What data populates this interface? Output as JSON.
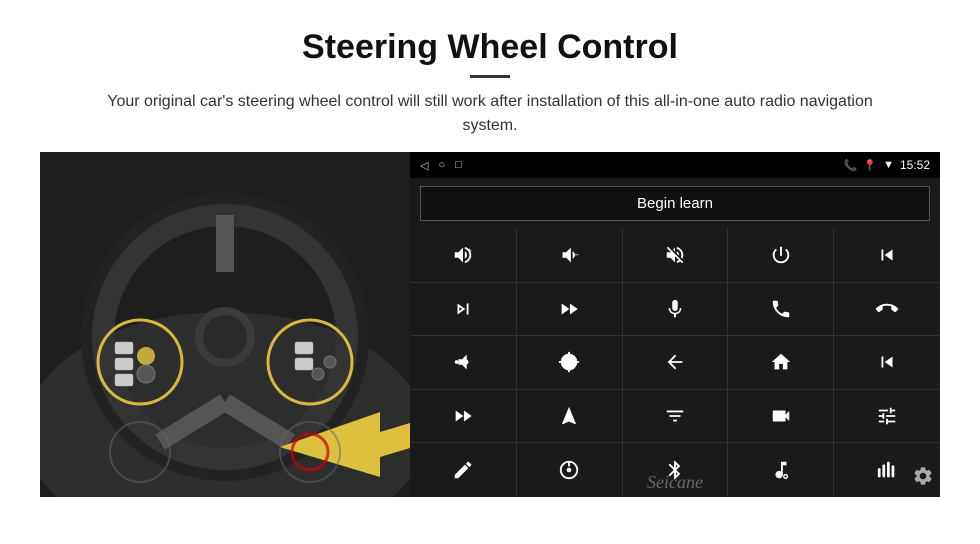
{
  "header": {
    "title": "Steering Wheel Control",
    "divider": true,
    "subtitle": "Your original car's steering wheel control will still work after installation of this all-in-one auto radio navigation system."
  },
  "statusBar": {
    "time": "15:52",
    "navIcons": [
      "◁",
      "○",
      "□"
    ]
  },
  "beginLearn": {
    "label": "Begin learn"
  },
  "watermark": "Seicane",
  "controlButtons": [
    {
      "id": "vol-up",
      "icon": "vol-up"
    },
    {
      "id": "vol-down",
      "icon": "vol-down"
    },
    {
      "id": "vol-mute",
      "icon": "vol-mute"
    },
    {
      "id": "power",
      "icon": "power"
    },
    {
      "id": "prev-track-phone",
      "icon": "prev-track-phone"
    },
    {
      "id": "next-track",
      "icon": "next-track"
    },
    {
      "id": "ff-track",
      "icon": "ff-track"
    },
    {
      "id": "mic",
      "icon": "mic"
    },
    {
      "id": "phone",
      "icon": "phone"
    },
    {
      "id": "hang-up",
      "icon": "hang-up"
    },
    {
      "id": "speaker",
      "icon": "speaker"
    },
    {
      "id": "360-view",
      "icon": "360-view"
    },
    {
      "id": "back",
      "icon": "back"
    },
    {
      "id": "home",
      "icon": "home"
    },
    {
      "id": "skip-back",
      "icon": "skip-back"
    },
    {
      "id": "fast-forward",
      "icon": "fast-forward"
    },
    {
      "id": "navigate",
      "icon": "navigate"
    },
    {
      "id": "equalizer",
      "icon": "equalizer"
    },
    {
      "id": "camera-rec",
      "icon": "camera-rec"
    },
    {
      "id": "settings-eq",
      "icon": "settings-eq"
    },
    {
      "id": "pen",
      "icon": "pen"
    },
    {
      "id": "steering-control",
      "icon": "steering-control"
    },
    {
      "id": "bluetooth",
      "icon": "bluetooth"
    },
    {
      "id": "music-settings",
      "icon": "music-settings"
    },
    {
      "id": "audio-bars",
      "icon": "audio-bars"
    }
  ]
}
